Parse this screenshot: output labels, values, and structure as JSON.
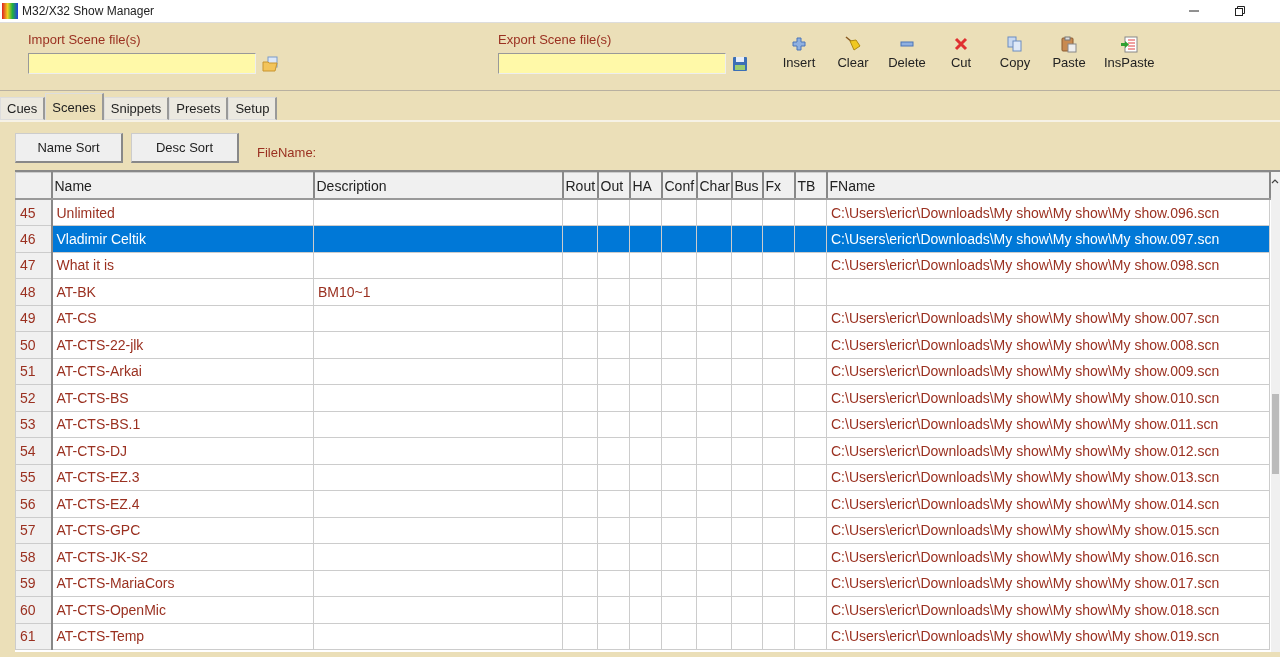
{
  "window": {
    "title": "M32/X32 Show Manager"
  },
  "import": {
    "label": "Import Scene file(s)"
  },
  "export": {
    "label": "Export Scene file(s)"
  },
  "toolbar": [
    {
      "label": "Insert",
      "kind": "plus"
    },
    {
      "label": "Clear",
      "kind": "broom"
    },
    {
      "label": "Delete",
      "kind": "minus"
    },
    {
      "label": "Cut",
      "kind": "cross"
    },
    {
      "label": "Copy",
      "kind": "copy"
    },
    {
      "label": "Paste",
      "kind": "paste"
    },
    {
      "label": "InsPaste",
      "kind": "inspaste"
    }
  ],
  "tabs": [
    {
      "label": "Cues",
      "selected": false
    },
    {
      "label": "Scenes",
      "selected": true
    },
    {
      "label": "Snippets",
      "selected": false
    },
    {
      "label": "Presets",
      "selected": false
    },
    {
      "label": "Setup",
      "selected": false
    }
  ],
  "sort_buttons": [
    "Name Sort",
    "Desc Sort"
  ],
  "filename_label": "FileName:",
  "table": {
    "columns": [
      "Name",
      "Description",
      "Rout",
      "Out",
      "HA",
      "Conf",
      "Char",
      "Bus",
      "Fx",
      "TB",
      "FName"
    ],
    "rows": [
      {
        "num": "45",
        "name": "Unlimited",
        "description": "",
        "fname": "C:\\Users\\ericr\\Downloads\\My show\\My show\\My show.096.scn",
        "selected": false
      },
      {
        "num": "46",
        "name": "Vladimir Celtik",
        "description": "",
        "fname": "C:\\Users\\ericr\\Downloads\\My show\\My show\\My show.097.scn",
        "selected": true
      },
      {
        "num": "47",
        "name": "What it is",
        "description": "",
        "fname": "C:\\Users\\ericr\\Downloads\\My show\\My show\\My show.098.scn",
        "selected": false
      },
      {
        "num": "48",
        "name": "AT-BK",
        "description": "BM10~1",
        "fname": "",
        "selected": false
      },
      {
        "num": "49",
        "name": "AT-CS",
        "description": "",
        "fname": "C:\\Users\\ericr\\Downloads\\My show\\My show\\My show.007.scn",
        "selected": false
      },
      {
        "num": "50",
        "name": "AT-CTS-22-jlk",
        "description": "",
        "fname": "C:\\Users\\ericr\\Downloads\\My show\\My show\\My show.008.scn",
        "selected": false
      },
      {
        "num": "51",
        "name": "AT-CTS-Arkai",
        "description": "",
        "fname": "C:\\Users\\ericr\\Downloads\\My show\\My show\\My show.009.scn",
        "selected": false
      },
      {
        "num": "52",
        "name": "AT-CTS-BS",
        "description": "",
        "fname": "C:\\Users\\ericr\\Downloads\\My show\\My show\\My show.010.scn",
        "selected": false
      },
      {
        "num": "53",
        "name": "AT-CTS-BS.1",
        "description": "",
        "fname": "C:\\Users\\ericr\\Downloads\\My show\\My show\\My show.011.scn",
        "selected": false
      },
      {
        "num": "54",
        "name": "AT-CTS-DJ",
        "description": "",
        "fname": "C:\\Users\\ericr\\Downloads\\My show\\My show\\My show.012.scn",
        "selected": false
      },
      {
        "num": "55",
        "name": "AT-CTS-EZ.3",
        "description": "",
        "fname": "C:\\Users\\ericr\\Downloads\\My show\\My show\\My show.013.scn",
        "selected": false
      },
      {
        "num": "56",
        "name": "AT-CTS-EZ.4",
        "description": "",
        "fname": "C:\\Users\\ericr\\Downloads\\My show\\My show\\My show.014.scn",
        "selected": false
      },
      {
        "num": "57",
        "name": "AT-CTS-GPC",
        "description": "",
        "fname": "C:\\Users\\ericr\\Downloads\\My show\\My show\\My show.015.scn",
        "selected": false
      },
      {
        "num": "58",
        "name": "AT-CTS-JK-S2",
        "description": "",
        "fname": "C:\\Users\\ericr\\Downloads\\My show\\My show\\My show.016.scn",
        "selected": false
      },
      {
        "num": "59",
        "name": "AT-CTS-MariaCors",
        "description": "",
        "fname": "C:\\Users\\ericr\\Downloads\\My show\\My show\\My show.017.scn",
        "selected": false
      },
      {
        "num": "60",
        "name": "AT-CTS-OpenMic",
        "description": "",
        "fname": "C:\\Users\\ericr\\Downloads\\My show\\My show\\My show.018.scn",
        "selected": false
      },
      {
        "num": "61",
        "name": "AT-CTS-Temp",
        "description": "",
        "fname": "C:\\Users\\ericr\\Downloads\\My show\\My show\\My show.019.scn",
        "selected": false
      }
    ]
  }
}
